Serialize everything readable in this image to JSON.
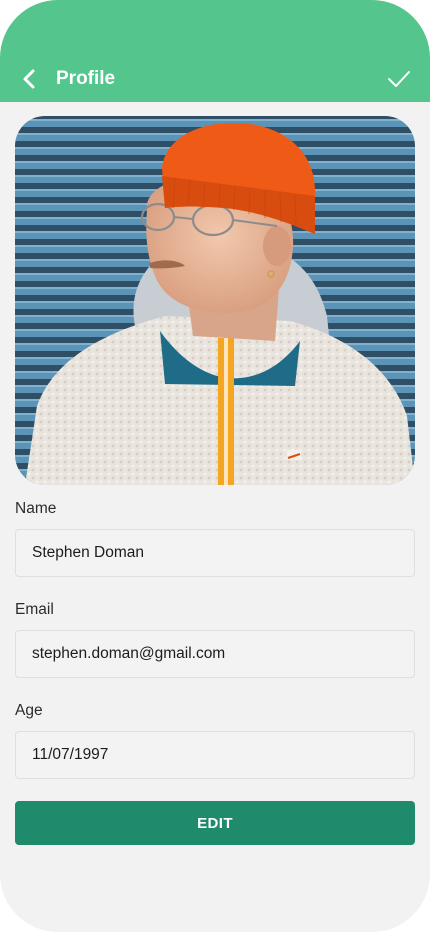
{
  "header": {
    "title": "Profile",
    "background_color": "#55c58e",
    "back_icon": "chevron-left-icon",
    "confirm_icon": "checkmark-icon"
  },
  "profile_photo": {
    "subject": "man in orange beanie and fleece jacket"
  },
  "form": {
    "name": {
      "label": "Name",
      "value": "Stephen Doman"
    },
    "email": {
      "label": "Email",
      "value": "stephen.doman@gmail.com"
    },
    "age": {
      "label": "Age",
      "value": "11/07/1997"
    }
  },
  "actions": {
    "edit_label": "EDIT",
    "edit_color": "#1f8a6c"
  }
}
